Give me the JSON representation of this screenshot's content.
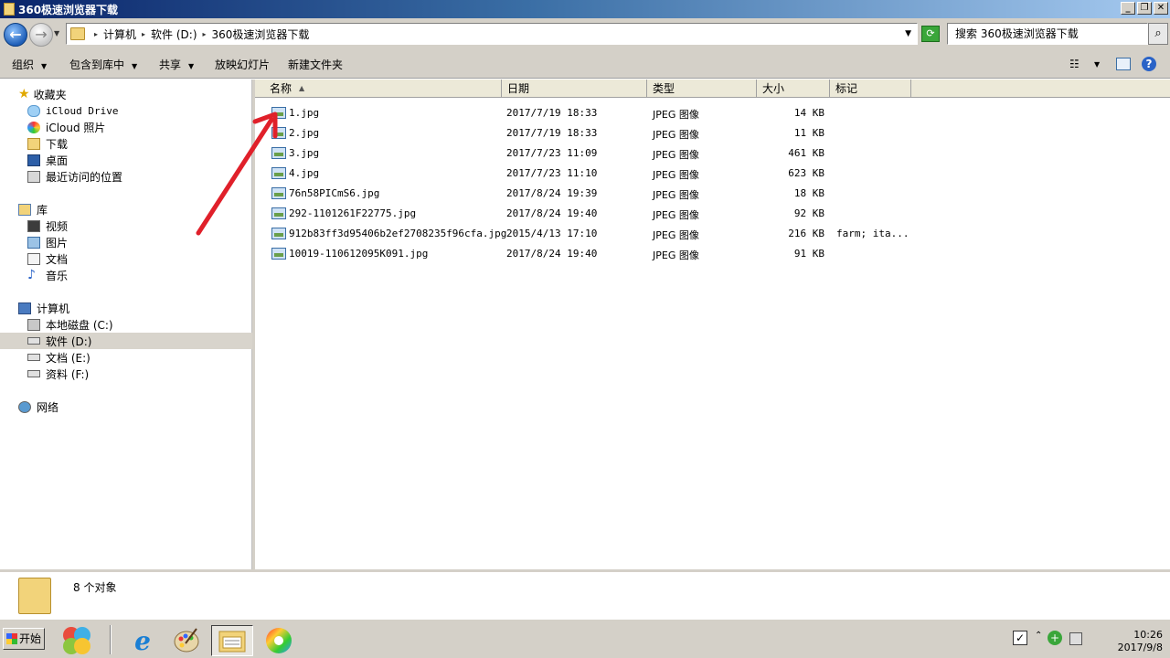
{
  "window": {
    "title": "360极速浏览器下载"
  },
  "address": {
    "crumbs": [
      "计算机",
      "软件 (D:)",
      "360极速浏览器下载"
    ],
    "search_placeholder": "搜索 360极速浏览器下载"
  },
  "toolbar": {
    "organize": "组织",
    "include_library": "包含到库中",
    "share": "共享",
    "slideshow": "放映幻灯片",
    "new_folder": "新建文件夹"
  },
  "nav": {
    "favorites": "收藏夹",
    "icloud_drive": "iCloud Drive",
    "icloud_photos": "iCloud 照片",
    "downloads": "下载",
    "desktop": "桌面",
    "recent": "最近访问的位置",
    "libraries": "库",
    "videos": "视频",
    "pictures": "图片",
    "documents": "文档",
    "music": "音乐",
    "computer": "计算机",
    "drive_c": "本地磁盘 (C:)",
    "drive_d": "软件 (D:)",
    "drive_e": "文档 (E:)",
    "drive_f": "资料 (F:)",
    "network": "网络"
  },
  "columns": {
    "name": "名称",
    "date": "日期",
    "type": "类型",
    "size": "大小",
    "tags": "标记"
  },
  "files": [
    {
      "name": "1.jpg",
      "date": "2017/7/19 18:33",
      "type": "JPEG 图像",
      "size": "14 KB",
      "tags": ""
    },
    {
      "name": "2.jpg",
      "date": "2017/7/19 18:33",
      "type": "JPEG 图像",
      "size": "11 KB",
      "tags": ""
    },
    {
      "name": "3.jpg",
      "date": "2017/7/23 11:09",
      "type": "JPEG 图像",
      "size": "461 KB",
      "tags": ""
    },
    {
      "name": "4.jpg",
      "date": "2017/7/23 11:10",
      "type": "JPEG 图像",
      "size": "623 KB",
      "tags": ""
    },
    {
      "name": "76n58PICmS6.jpg",
      "date": "2017/8/24 19:39",
      "type": "JPEG 图像",
      "size": "18 KB",
      "tags": ""
    },
    {
      "name": "292-1101261F22775.jpg",
      "date": "2017/8/24 19:40",
      "type": "JPEG 图像",
      "size": "92 KB",
      "tags": ""
    },
    {
      "name": "912b83ff3d95406b2ef2708235f96cfa.jpg",
      "date": "2015/4/13 17:10",
      "type": "JPEG 图像",
      "size": "216 KB",
      "tags": "farm; ita..."
    },
    {
      "name": "10019-110612095K091.jpg",
      "date": "2017/8/24 19:40",
      "type": "JPEG 图像",
      "size": "91 KB",
      "tags": ""
    }
  ],
  "details": {
    "count": "8 个对象"
  },
  "taskbar": {
    "start": "开始",
    "time": "10:26",
    "date": "2017/9/8"
  },
  "colors": {
    "accent": "#0a246a",
    "chrome": "#d4d0c8",
    "arrow": "#e0202a"
  }
}
